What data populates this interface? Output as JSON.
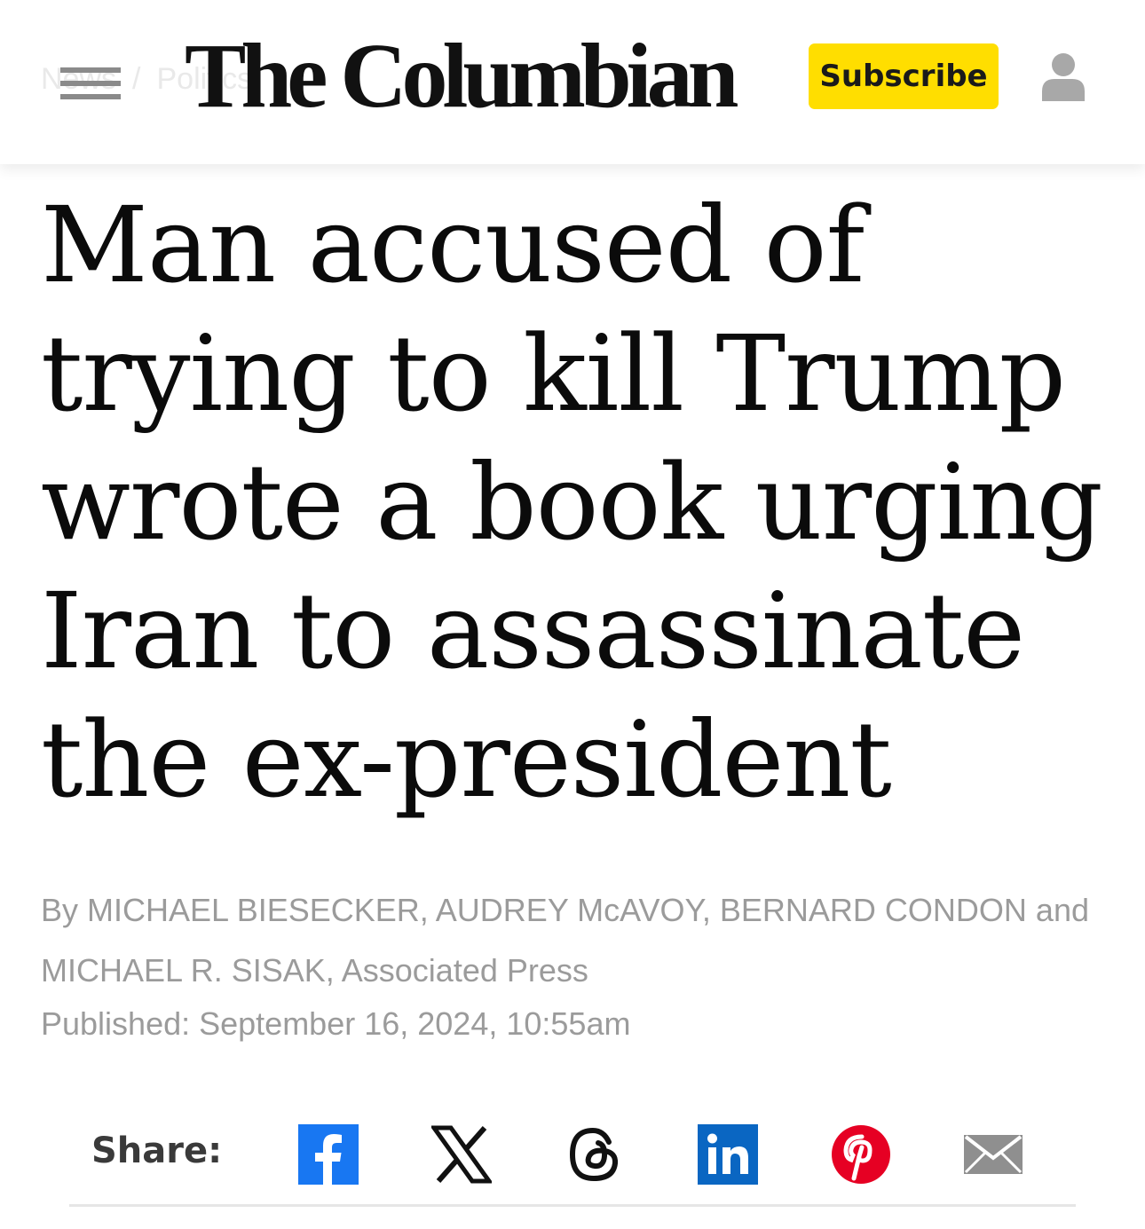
{
  "header": {
    "breadcrumb": [
      "News",
      "Politics"
    ],
    "logo_text": "The Columbian",
    "subscribe_label": "Subscribe",
    "menu_icon": "hamburger-icon",
    "account_icon": "user-icon"
  },
  "article": {
    "headline": "Man accused of trying to kill Trump wrote a book urging Iran to assassinate the ex-president",
    "byline": "By MICHAEL BIESECKER, AUDREY McAVOY, BERNARD CONDON and MICHAEL R. SISAK, Associated Press",
    "published": "Published: September 16, 2024, 10:55am"
  },
  "share": {
    "label": "Share:",
    "icons": [
      "facebook-icon",
      "x-icon",
      "threads-icon",
      "linkedin-icon",
      "pinterest-icon",
      "email-icon"
    ]
  },
  "colors": {
    "subscribe_bg": "#ffde00",
    "facebook": "#1877f2",
    "linkedin": "#0a66c2",
    "pinterest": "#e60023",
    "email": "#8f8f8f"
  }
}
